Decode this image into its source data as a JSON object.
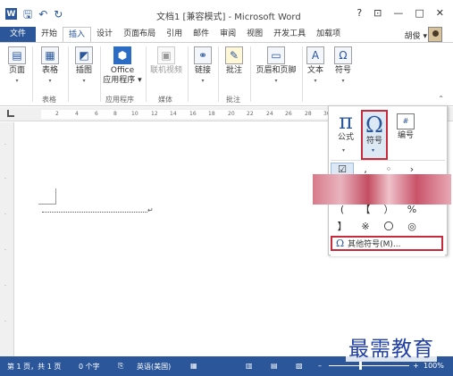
{
  "window": {
    "title": "文档1 [兼容模式] - Microsoft Word",
    "controls": [
      "?",
      "⊡",
      "—",
      "□",
      "✕"
    ]
  },
  "quick_access": [
    "save-icon",
    "undo-icon",
    "redo-icon"
  ],
  "tabs": [
    {
      "label": "文件"
    },
    {
      "label": "开始"
    },
    {
      "label": "插入"
    },
    {
      "label": "设计"
    },
    {
      "label": "页面布局"
    },
    {
      "label": "引用"
    },
    {
      "label": "邮件"
    },
    {
      "label": "审阅"
    },
    {
      "label": "视图"
    },
    {
      "label": "开发工具"
    },
    {
      "label": "加载项"
    }
  ],
  "account": {
    "name": "胡俊 ▾"
  },
  "ribbon": {
    "buttons": {
      "pages": "页面",
      "table": "表格",
      "illustrations": "插图",
      "office_apps_line1": "Office",
      "office_apps_line2": "应用程序 ▾",
      "online_video": "联机视频",
      "link": "链接",
      "comment": "批注",
      "header_footer": "页眉和页脚",
      "text": "文本",
      "symbols": "符号"
    },
    "groups": {
      "table": "表格",
      "apps": "应用程序",
      "media": "媒体",
      "comment": "批注"
    }
  },
  "ruler": {
    "ticks": [
      "2",
      "4",
      "6",
      "8",
      "10",
      "12",
      "14",
      "16",
      "18",
      "20",
      "22",
      "24",
      "26",
      "28",
      "30"
    ]
  },
  "symbols_panel": {
    "formula": "公式",
    "symbol": "符号",
    "number": "编号",
    "gallery_rows": [
      [
        "☑",
        "‚",
        "◦",
        "›"
      ],
      [
        "(",
        "【",
        "）",
        "%"
      ],
      [
        "】",
        "※",
        "〇",
        "◎"
      ]
    ],
    "more_symbols": "其他符号(M)..."
  },
  "statusbar": {
    "page": "第 1 页，共 1 页",
    "words": "0 个字",
    "language": "英语(美国)",
    "zoom": "100%"
  },
  "watermark": "最需教育",
  "colors": {
    "accent": "#2b579a",
    "highlight": "#c72a3a"
  }
}
